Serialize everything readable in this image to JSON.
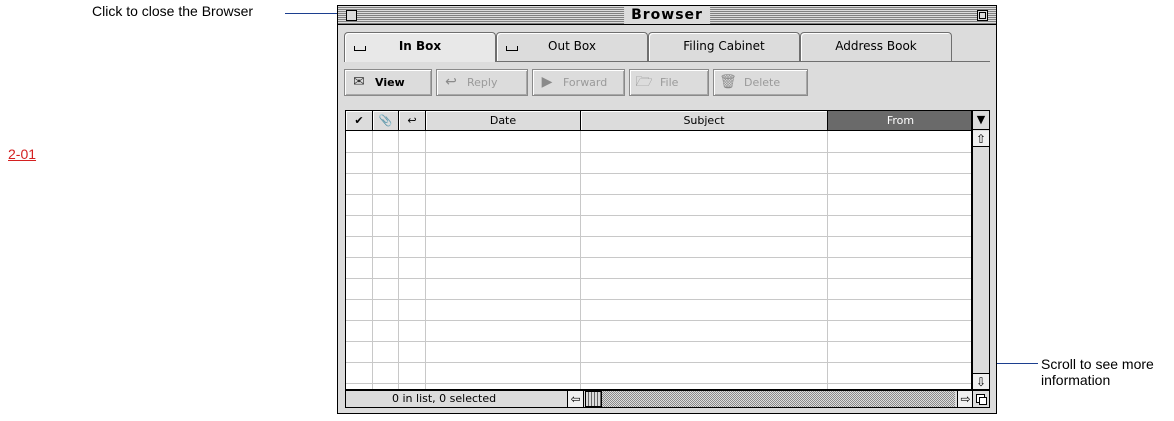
{
  "annotations": {
    "close_label": "Click to close the Browser",
    "scroll_label_line1": "Scroll to see more",
    "scroll_label_line2": "information",
    "figure_link": "2-01"
  },
  "window": {
    "title": "Browser"
  },
  "tabs": [
    {
      "label": "In Box",
      "active": true,
      "icon": "mailbox-icon"
    },
    {
      "label": "Out Box",
      "active": false,
      "icon": "mailbox-icon"
    },
    {
      "label": "Filing Cabinet",
      "active": false
    },
    {
      "label": "Address Book",
      "active": false
    }
  ],
  "toolbar": {
    "view_label": "View",
    "reply_label": "Reply",
    "forward_label": "Forward",
    "file_label": "File",
    "delete_label": "Delete"
  },
  "table": {
    "columns": {
      "check": "✔",
      "attach": "📎",
      "reply": "↩",
      "date": "Date",
      "subject": "Subject",
      "from": "From"
    },
    "sorted_by": "From",
    "rows": []
  },
  "status": {
    "text": "0 in list, 0 selected"
  },
  "colors": {
    "window_bg": "#dcdcdc",
    "sorted_header": "#6a6a6a",
    "annotation_line": "#1c3f8f",
    "figure_link": "#d42020"
  }
}
